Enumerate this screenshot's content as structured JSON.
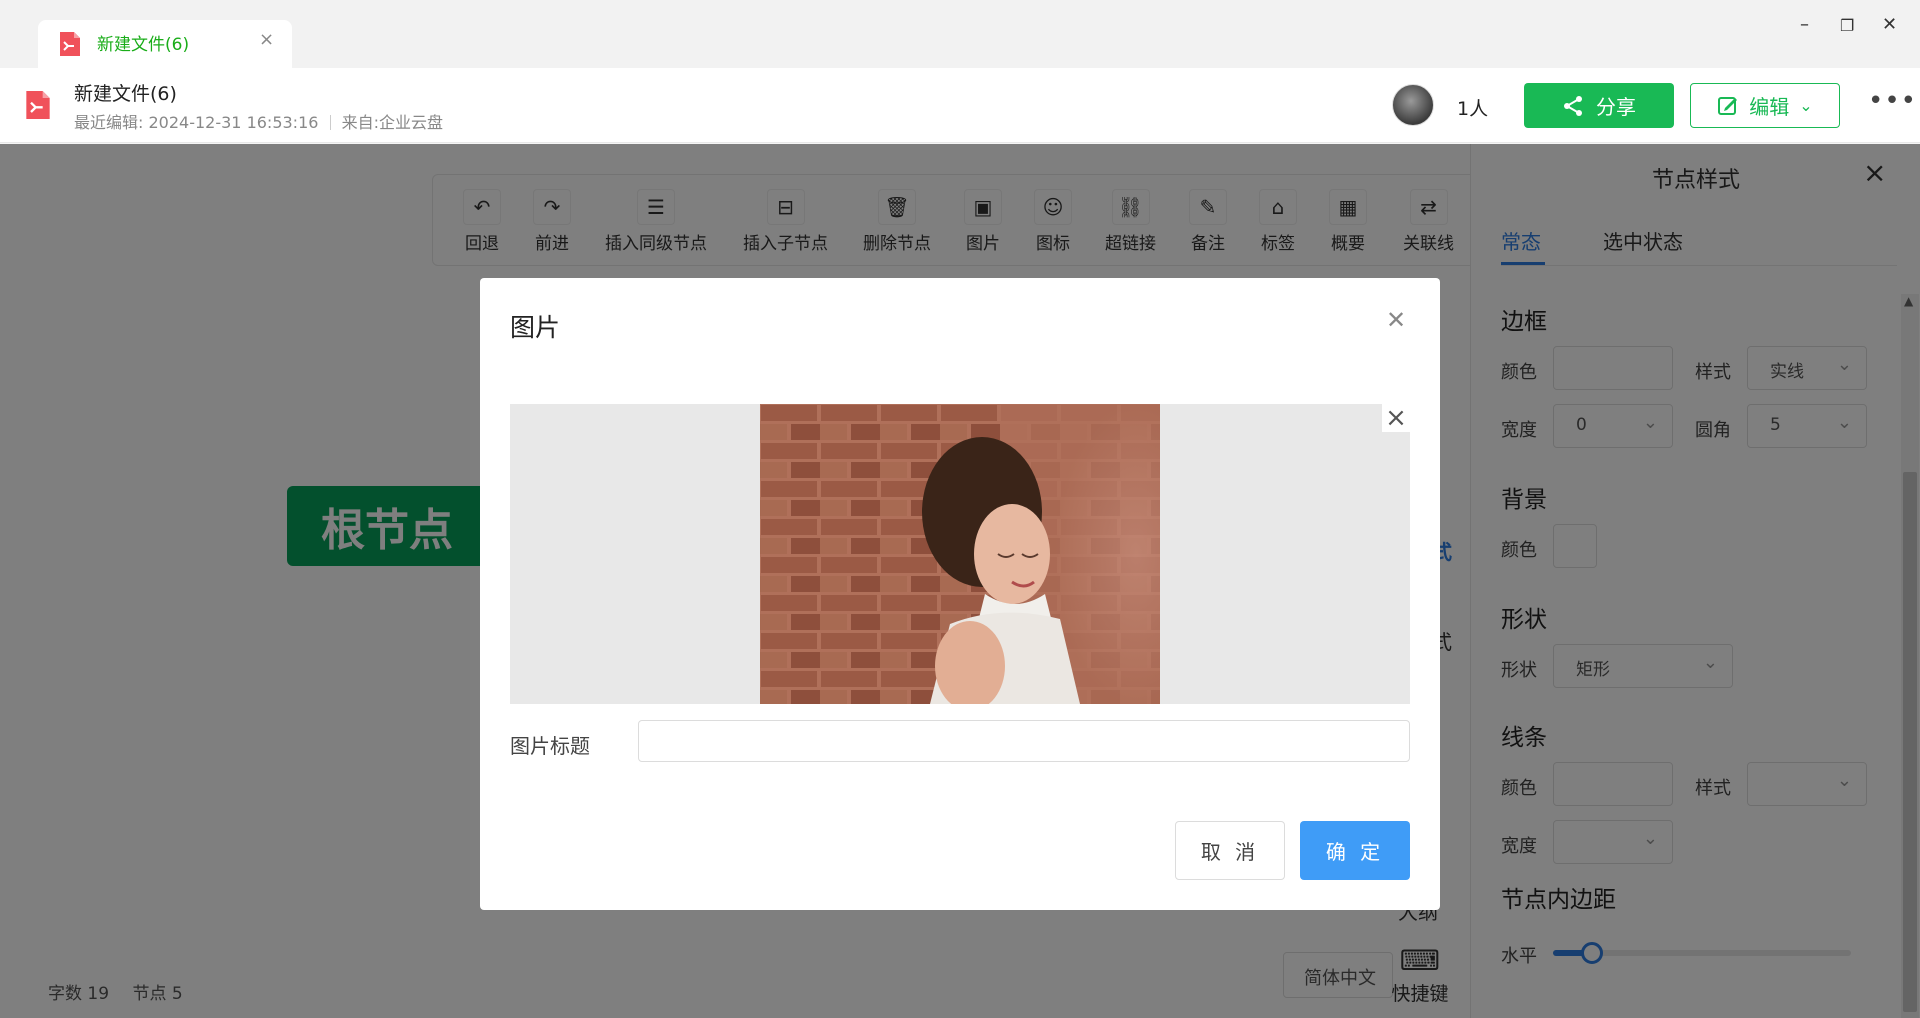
{
  "tab": {
    "title": "新建文件(6)",
    "close": "×"
  },
  "window": {
    "minimize": "–",
    "maximize": "❐",
    "close": "✕"
  },
  "header": {
    "title": "新建文件(6)",
    "last_edit_label": "最近编辑:",
    "last_edit_time": "2024-12-31 16:53:16",
    "source": "来自:企业云盘",
    "people": "1人",
    "share_label": "分享",
    "edit_label": "编辑",
    "more": "•••"
  },
  "toolbar": {
    "items": [
      {
        "label": "回退",
        "icon": "↶"
      },
      {
        "label": "前进",
        "icon": "↷"
      },
      {
        "label": "插入同级节点",
        "icon": "☰"
      },
      {
        "label": "插入子节点",
        "icon": "⊟"
      },
      {
        "label": "删除节点",
        "icon": "🗑"
      },
      {
        "label": "图片",
        "icon": "▣"
      },
      {
        "label": "图标",
        "icon": "☺"
      },
      {
        "label": "超链接",
        "icon": "⛓"
      },
      {
        "label": "备注",
        "icon": "✎"
      },
      {
        "label": "标签",
        "icon": "⌂"
      },
      {
        "label": "概要",
        "icon": "▦"
      },
      {
        "label": "关联线",
        "icon": "⇄"
      }
    ]
  },
  "canvas": {
    "root_node": "根节点",
    "side_fragments": [
      "式",
      "式",
      "大纲"
    ],
    "status_words_label": "字数",
    "status_words": "19",
    "status_nodes_label": "节点",
    "status_nodes": "5",
    "language": "简体中文",
    "shortcut_label": "快捷键"
  },
  "panel": {
    "title": "节点样式",
    "tabs": [
      "常态",
      "选中状态"
    ],
    "border": {
      "section": "边框",
      "color_label": "颜色",
      "style_label": "样式",
      "style_value": "实线",
      "width_label": "宽度",
      "width_value": "0",
      "radius_label": "圆角",
      "radius_value": "5"
    },
    "background": {
      "section": "背景",
      "color_label": "颜色"
    },
    "shape": {
      "section": "形状",
      "shape_label": "形状",
      "shape_value": "矩形"
    },
    "line": {
      "section": "线条",
      "color_label": "颜色",
      "style_label": "样式",
      "width_label": "宽度"
    },
    "padding": {
      "section": "节点内边距",
      "horizontal_label": "水平",
      "horizontal_level": 0.13
    }
  },
  "modal": {
    "title": "图片",
    "caption_label": "图片标题",
    "caption_value": "",
    "cancel_label": "取 消",
    "ok_label": "确 定"
  },
  "colors": {
    "brand_green": "#19b955",
    "node_green": "#07a15a",
    "accent_blue": "#2e7de0",
    "ok_blue": "#3f9cf7"
  }
}
